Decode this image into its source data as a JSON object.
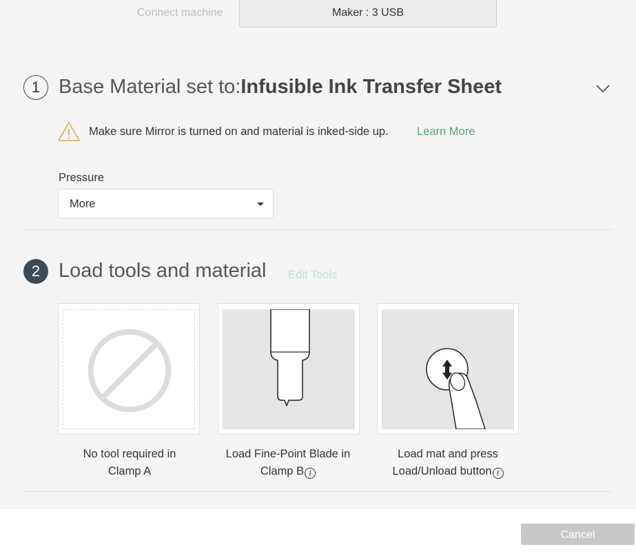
{
  "header": {
    "connect_label": "Connect machine",
    "machine_value": "Maker : 3 USB"
  },
  "step1": {
    "number": "1",
    "title_prefix": "Base Material set to:",
    "material": "Infusible Ink Transfer Sheet",
    "warning_text": "Make sure Mirror is turned on and material is inked-side up.",
    "learn_more": "Learn More",
    "pressure_label": "Pressure",
    "pressure_value": "More"
  },
  "step2": {
    "number": "2",
    "title": "Load tools and material",
    "edit_tools": "Edit Tools",
    "cards": [
      {
        "line1": "No tool required in",
        "line2": "Clamp A"
      },
      {
        "line1": "Load Fine-Point Blade in",
        "line2": "Clamp B"
      },
      {
        "line1": "Load mat and press",
        "line2": "Load/Unload button"
      }
    ],
    "info_glyph": "i"
  },
  "footer": {
    "cancel_label": "Cancel"
  },
  "icons": {
    "warning": "warning-triangle-icon",
    "chevron": "chevron-down-icon",
    "no_tool": "no-tool-icon",
    "blade": "fine-point-blade-icon",
    "load_button": "load-unload-button-icon",
    "info": "info-icon"
  },
  "colors": {
    "accent_green": "#5aa479",
    "step_active": "#3f4a54",
    "button_disabled": "#c8c8c8",
    "warning": "#d8b56a"
  }
}
